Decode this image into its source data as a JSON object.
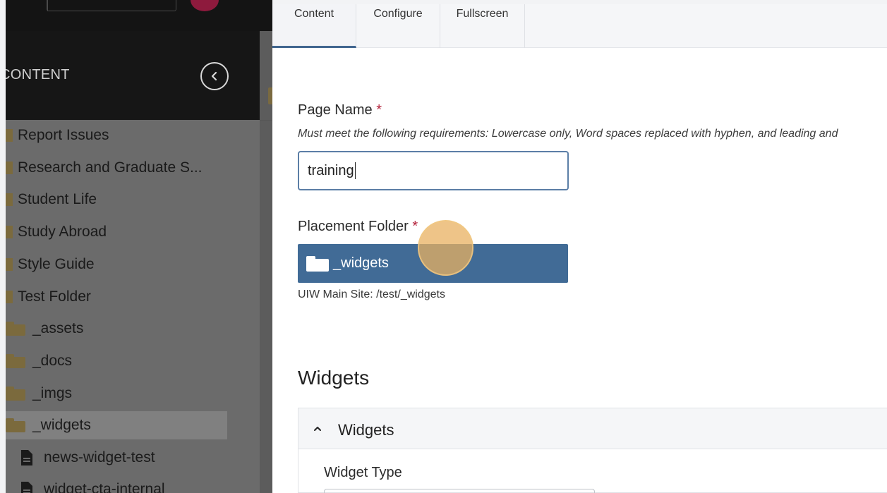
{
  "sidebar": {
    "header_title": "CONTENT",
    "items": [
      {
        "label": "Report Issues",
        "kind": "folder-partial"
      },
      {
        "label": "Research and Graduate S...",
        "kind": "folder-partial"
      },
      {
        "label": "Student Life",
        "kind": "folder-partial"
      },
      {
        "label": "Study Abroad",
        "kind": "folder-partial"
      },
      {
        "label": "Style Guide",
        "kind": "folder-partial"
      },
      {
        "label": "Test Folder",
        "kind": "folder-partial"
      },
      {
        "label": "_assets",
        "kind": "folder"
      },
      {
        "label": "_docs",
        "kind": "folder"
      },
      {
        "label": "_imgs",
        "kind": "folder"
      },
      {
        "label": "_widgets",
        "kind": "folder",
        "selected": true
      },
      {
        "label": "news-widget-test",
        "kind": "page"
      },
      {
        "label": "widget-cta-internal",
        "kind": "page"
      }
    ]
  },
  "tabs": [
    {
      "label": "Content",
      "active": true
    },
    {
      "label": "Configure",
      "active": false
    },
    {
      "label": "Fullscreen",
      "active": false
    }
  ],
  "form": {
    "page_name_label": "Page Name",
    "required_mark": "*",
    "page_name_hint": "Must meet the following requirements: Lowercase only, Word spaces replaced with hyphen, and leading and",
    "page_name_value": "training",
    "placement_folder_label": "Placement Folder",
    "placement_folder_value": "_widgets",
    "placement_path": "UIW Main Site: /test/_widgets"
  },
  "widgets": {
    "section_title": "Widgets",
    "accordion_title": "Widgets",
    "widget_type_label": "Widget Type"
  },
  "colors": {
    "accent": "#416b96",
    "required": "#b4233c",
    "tab_underline": "#41668f"
  }
}
